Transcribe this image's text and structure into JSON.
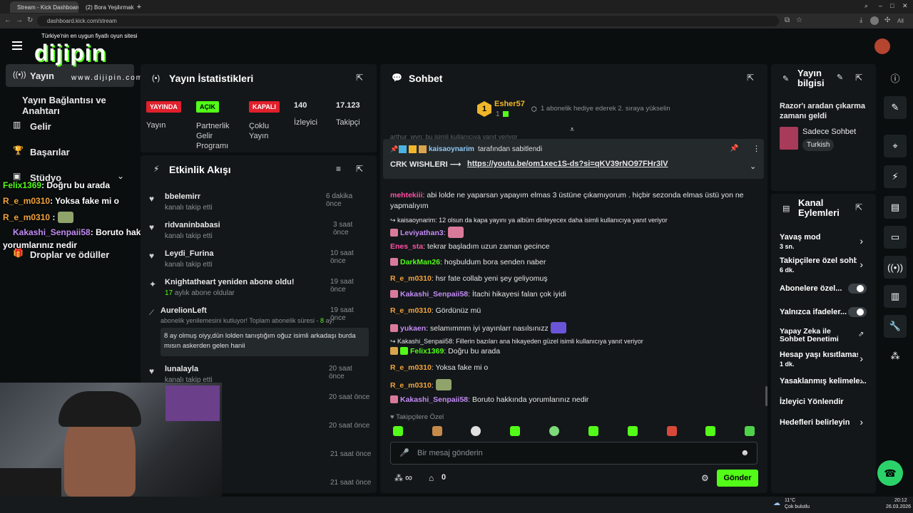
{
  "browser": {
    "tabs": [
      {
        "label": "Stream - Kick Dashboard",
        "active": true
      },
      {
        "label": "(2) Bora Yeşilırmak (@Bor..."
      }
    ],
    "url": "dashboard.kick.com/stream",
    "zoom": "All"
  },
  "overlay": {
    "promo": "Türkiye'nin en uygun fiyatlı oyun sitesi",
    "logo_big": "dijipin",
    "logo_small": "www.dijipin.com",
    "chat": [
      {
        "user": "Felix1369",
        "msg": ": Doğru bu arada",
        "color": "#53fc18"
      },
      {
        "user": "R_e_m0310",
        "msg": ": Yoksa fake mi o",
        "color": "#f3a33a"
      },
      {
        "user": "R_e_m0310",
        "msg": " :",
        "color": "#f3a33a"
      },
      {
        "user": "Kakashi_Senpaii58",
        "msg": ": Boruto hakkında",
        "color": "#c38bf5"
      }
    ],
    "chat_wrap": "yorumlarınız nedir"
  },
  "nav": {
    "items": [
      {
        "label": "Yayın",
        "icon": "broadcast-icon"
      },
      {
        "label": "Yayın Bağlantısı ve Anahtarı",
        "icon": "link-icon"
      },
      {
        "label": "Gelir",
        "icon": "chart-icon"
      },
      {
        "label": "Başarılar",
        "icon": "trophy-icon"
      },
      {
        "label": "Stüdyo",
        "icon": "studio-icon"
      },
      {
        "label": "Droplar ve ödüller",
        "icon": "gift-icon"
      }
    ]
  },
  "stats": {
    "title": "Yayın İstatistikleri",
    "badges": [
      {
        "tag": "YAYINDA",
        "label": "Yayın",
        "bg": "#e0202c",
        "fg": "#fff"
      },
      {
        "tag": "AÇIK",
        "label": "Partnerlik Gelir Programı",
        "bg": "#53fc18",
        "fg": "#000"
      },
      {
        "tag": "KAPALI",
        "label": "Çoklu Yayın",
        "bg": "#e0202c",
        "fg": "#fff"
      }
    ],
    "viewers": {
      "value": "140",
      "label": "İzleyici"
    },
    "followers": {
      "value": "17.123",
      "label": "Takipçi"
    }
  },
  "activity": {
    "title": "Etkinlik Akışı",
    "items": [
      {
        "name": "bbelemirr",
        "sub": "kanalı takip etti",
        "time": "6 dakika önce"
      },
      {
        "name": "ridvaninbabasi",
        "sub": "kanalı takip etti",
        "time": "3 saat önce"
      },
      {
        "name": "Leydi_Furina",
        "sub": "kanalı takip etti",
        "time": "10 saat önce"
      },
      {
        "name": "Knightatheart yeniden abone oldu!",
        "sub_green": "17",
        "sub": "aylık abone oldular",
        "time": "19 saat önce"
      },
      {
        "name": "AurelionLeft",
        "sub": "abonelik yenilemesini kutluyor! Toplam abonelik süresi -",
        "sub_green": "8",
        "sub_tail": "ay!",
        "time": "19 saat önce",
        "message": "8 ay olmuş oiyy,dün lolden tanıştığım oğuz isimli arkadaşı burda mısın askerden gelen hanii"
      },
      {
        "name": "lunalayla",
        "sub": "kanalı takip etti",
        "time": "20 saat önce"
      },
      {
        "time": "20 saat önce"
      },
      {
        "time": "20 saat önce"
      },
      {
        "time": "21 saat önce"
      },
      {
        "time": "21 saat önce"
      }
    ]
  },
  "chat": {
    "title": "Sohbet",
    "gift": {
      "rank": "1",
      "user": "Esher57",
      "count": "1",
      "text": "1 abonelik hediye ederek 2. sıraya yükselin"
    },
    "pinned": {
      "by": "kaisaoynarim",
      "by_suffix": "tarafından sabitlendi",
      "text": "CRK WISHLERI ⟶",
      "link": "https://youtu.be/om1xec1S-ds?si=qKV39rNO97FHr3lV",
      "faded_top": "arthur_wyn: bu isimli kullanıcıya yanıt veriyor"
    },
    "messages": [
      {
        "user": "mehtekiii",
        "color": "#ff4fa3",
        "text": "abi lolde ne yaparsan yapayım elmas 3 üstüne çıkamıyorum . hiçbir sezonda elmas üstü yon ne",
        "text2": "yapmalıyım"
      },
      {
        "reply": "kaisaoynarim: 12 olsun da kapa yayını ya albüm dinleyecex daha isimli kullanıcıya yanıt veriyor"
      },
      {
        "user": "Leviyathan3",
        "color": "#c38bf5",
        "text": "",
        "emote": "#d97a9a"
      },
      {
        "user": "Enes_sta",
        "color": "#ff4fa3",
        "text": "tekrar başladım uzun zaman gecince"
      },
      {
        "user": "DarkMan26",
        "color": "#53fc18",
        "text": "hoşbuldum bora senden naber"
      },
      {
        "user": "R_e_m0310",
        "color": "#f3a33a",
        "text": "hsr fate collab yeni şey geliyomuş"
      },
      {
        "user": "Kakashi_Senpaii58",
        "color": "#c38bf5",
        "text": "İtachi hikayesi falan çok iyidi"
      },
      {
        "user": "R_e_m0310",
        "color": "#f3a33a",
        "text": "Gördünüz mü"
      },
      {
        "user": "yukaen",
        "color": "#c38bf5",
        "text": "selamımmm iyi yayınlarr nasılsınızz",
        "emote": "#6a55d8"
      },
      {
        "reply": "Kakashi_Senpaii58: Fillerin bazıları ana hikayeden güzel isimli kullanıcıya yanıt veriyor"
      },
      {
        "user": "Felix1369",
        "color": "#53fc18",
        "text": "Doğru bu arada"
      },
      {
        "user": "R_e_m0310",
        "color": "#f3a33a",
        "text": "Yoksa fake mi o"
      },
      {
        "user": "R_e_m0310",
        "color": "#f3a33a",
        "text": "",
        "emote": "#8fa36a"
      },
      {
        "user": "Kakashi_Senpaii58",
        "color": "#c38bf5",
        "text": "Boruto hakkında yorumlarınız nedir"
      }
    ],
    "followers_only": "Takipçilere Özel",
    "placeholder": "Bir mesaj gönderin",
    "infinity": "∞",
    "points": "0",
    "send": "Gönder"
  },
  "info": {
    "title": "Yayın bilgisi",
    "stream_title": "Razor'ı aradan çıkarma zamanı geldi",
    "category": "Sadece Sohbet",
    "tag": "Turkish"
  },
  "actions": {
    "title": "Kanal Eylemleri",
    "items": [
      {
        "label": "Yavaş mod",
        "sub": "3 sn.",
        "kind": "chevron"
      },
      {
        "label": "Takipçilere özel sohb",
        "sub": "6 dk.",
        "kind": "chevron"
      },
      {
        "label": "Abonelere özel...",
        "kind": "toggle"
      },
      {
        "label": "Yalnızca ifadeler...",
        "kind": "toggle"
      },
      {
        "label": "Yapay Zeka ile Sohbet Denetimi",
        "kind": "external"
      },
      {
        "label": "Hesap yaşı kısıtlaması",
        "sub": "1 dk.",
        "kind": "chevron"
      },
      {
        "label": "Yasaklanmış kelimele...",
        "kind": "chevron"
      },
      {
        "label": "İzleyici Yönlendir",
        "kind": "none"
      },
      {
        "label": "Hedefleri belirleyin",
        "kind": "chevron"
      }
    ]
  },
  "taskbar": {
    "weather_temp": "11°C",
    "weather_text": "Çok bulutlu",
    "time": "20:12",
    "date": "26.03.2026"
  }
}
